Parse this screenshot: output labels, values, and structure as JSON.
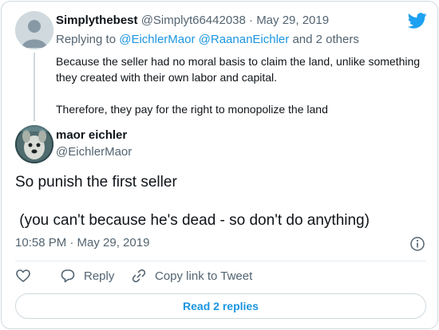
{
  "reply_to_tweet": {
    "display_name": "Simplythebest",
    "handle": "@Simplyt66442038",
    "separator": "·",
    "date": "May 29, 2019",
    "replying_prefix": "Replying to",
    "replying_users": "@EichlerMaor @RaananEichler",
    "replying_suffix": "and 2 others",
    "text_paragraphs": [
      "Because the seller had no moral basis to claim the land, unlike something they created with their own labor and capital.",
      "Therefore, they pay for the right to monopolize the land"
    ]
  },
  "main_tweet": {
    "display_name": "maor eichler",
    "handle": "@EichlerMaor",
    "text_paragraphs": [
      "So punish the first seller",
      " (you can't because he's dead - so don't do anything)"
    ],
    "timestamp": "10:58 PM · May 29, 2019"
  },
  "actions": {
    "reply_label": "Reply",
    "copy_link_label": "Copy link to Tweet"
  },
  "read_replies_label": "Read 2 replies",
  "icons": {
    "brand": "twitter-bird-icon",
    "like": "heart-icon",
    "reply": "speech-bubble-icon",
    "copy_link": "link-icon",
    "info": "info-icon"
  },
  "colors": {
    "brand_blue": "#1da1f2",
    "link_blue": "#1b95e0",
    "text": "#0f1419",
    "muted": "#536471",
    "border": "#cfd9de"
  }
}
